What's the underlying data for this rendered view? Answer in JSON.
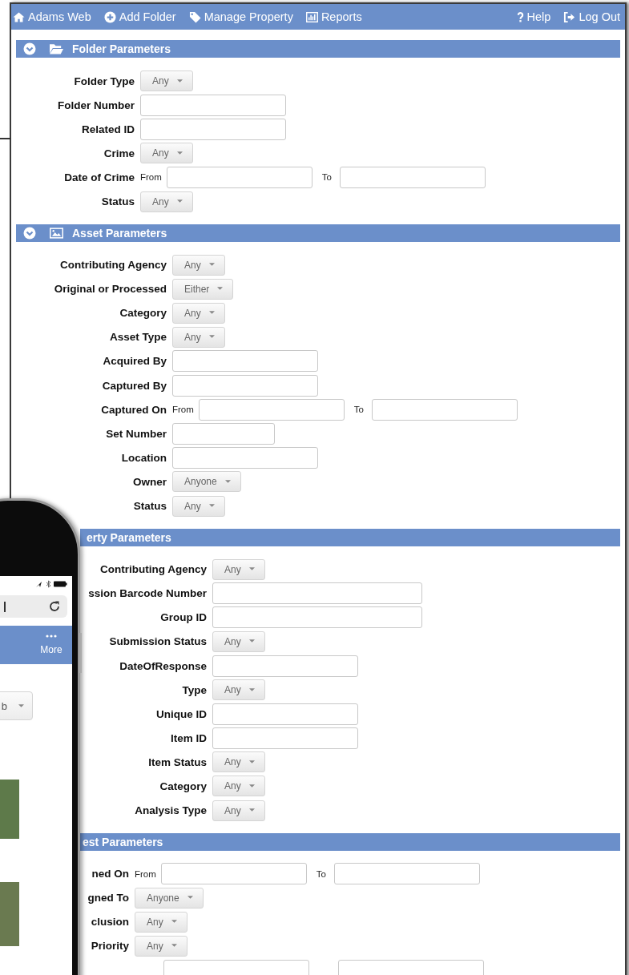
{
  "nav": {
    "left": [
      {
        "label": "Adams Web"
      },
      {
        "label": "Add Folder"
      },
      {
        "label": "Manage Property"
      },
      {
        "label": "Reports"
      }
    ],
    "right": [
      {
        "label": "Help"
      },
      {
        "label": "Log Out"
      }
    ]
  },
  "sections": [
    {
      "title": "Folder Parameters",
      "expanded": true,
      "fields": [
        {
          "label": "Folder Type",
          "kind": "select",
          "value": "Any"
        },
        {
          "label": "Folder Number",
          "kind": "input"
        },
        {
          "label": "Related ID",
          "kind": "input"
        },
        {
          "label": "Crime",
          "kind": "select",
          "value": "Any"
        },
        {
          "label": "Date of Crime",
          "kind": "date_range",
          "from": "From",
          "to": "To"
        },
        {
          "label": "Status",
          "kind": "select",
          "value": "Any"
        }
      ]
    },
    {
      "title": "Asset Parameters",
      "expanded": true,
      "fields": [
        {
          "label": "Contributing Agency",
          "kind": "select",
          "value": "Any"
        },
        {
          "label": "Original or Processed",
          "kind": "select",
          "value": "Either"
        },
        {
          "label": "Category",
          "kind": "select",
          "value": "Any"
        },
        {
          "label": "Asset Type",
          "kind": "select",
          "value": "Any"
        },
        {
          "label": "Acquired By",
          "kind": "input"
        },
        {
          "label": "Captured By",
          "kind": "input"
        },
        {
          "label": "Captured On",
          "kind": "date_range",
          "from": "From",
          "to": "To"
        },
        {
          "label": "Set Number",
          "kind": "input_short"
        },
        {
          "label": "Location",
          "kind": "input"
        },
        {
          "label": "Owner",
          "kind": "select",
          "value": "Anyone"
        },
        {
          "label": "Status",
          "kind": "select",
          "value": "Any"
        }
      ]
    },
    {
      "title": "erty Parameters",
      "expanded": true,
      "fields": [
        {
          "label": "Contributing Agency",
          "kind": "select",
          "value": "Any"
        },
        {
          "label": "ssion Barcode Number",
          "kind": "input_long"
        },
        {
          "label": "Group ID",
          "kind": "input_long"
        },
        {
          "label": "Submission Status",
          "kind": "select",
          "value": "Any"
        },
        {
          "label": "DateOfResponse",
          "kind": "input"
        },
        {
          "label": "Type",
          "kind": "select",
          "value": "Any"
        },
        {
          "label": "Unique ID",
          "kind": "input"
        },
        {
          "label": "Item ID",
          "kind": "input"
        },
        {
          "label": "Item Status",
          "kind": "select",
          "value": "Any"
        },
        {
          "label": "Category",
          "kind": "select",
          "value": "Any"
        },
        {
          "label": "Analysis Type",
          "kind": "select",
          "value": "Any"
        }
      ]
    },
    {
      "title": "est Parameters",
      "expanded": true,
      "fields": [
        {
          "label": "ned On",
          "kind": "date_range",
          "from": "From",
          "to": "To"
        },
        {
          "label": "gned To",
          "kind": "select",
          "value": "Anyone"
        },
        {
          "label": "clusion",
          "kind": "select",
          "value": "Any"
        },
        {
          "label": "Priority",
          "kind": "select",
          "value": "Any"
        },
        {
          "kind": "date_range"
        }
      ]
    }
  ],
  "phone": {
    "menu_label": "More",
    "dropdown_value": "b"
  }
}
